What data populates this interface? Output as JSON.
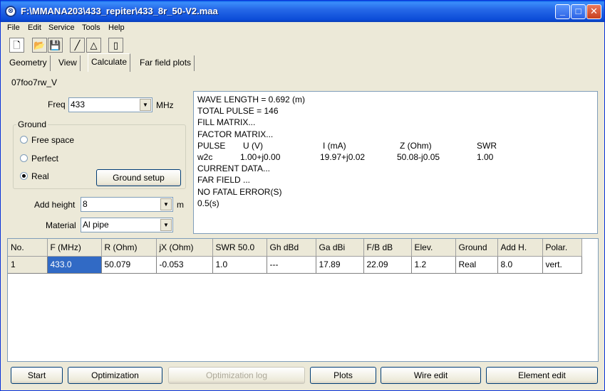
{
  "window": {
    "title": "F:\\MMANA203\\433_repiter\\433_8r_50-V2.maa"
  },
  "menu": [
    "File",
    "Edit",
    "Service",
    "Tools",
    "Help"
  ],
  "toolbar": {
    "icons": [
      "new-file-icon",
      "open-folder-icon",
      "save-disk-icon",
      "line-draw-icon",
      "triangle-icon",
      "document-icon"
    ],
    "glyphs": [
      "🗋",
      "📂",
      "💾",
      "╱",
      "△",
      "▯"
    ]
  },
  "tabs": [
    "Geometry",
    "View",
    "Calculate",
    "Far field plots"
  ],
  "antenna_name": "07foo7rw_V",
  "freq": {
    "label": "Freq",
    "value": "433",
    "unit": "MHz"
  },
  "ground": {
    "title": "Ground",
    "options": [
      "Free space",
      "Perfect",
      "Real"
    ],
    "selected": "Real",
    "setup_button": "Ground setup"
  },
  "add_height": {
    "label": "Add height",
    "value": "8",
    "unit": "m"
  },
  "material": {
    "label": "Material",
    "value": "Al pipe"
  },
  "output": {
    "lines": [
      "WAVE LENGTH = 0.692 (m)",
      "TOTAL PULSE = 146",
      "FILL MATRIX...",
      "FACTOR MATRIX..."
    ],
    "pulse_header": [
      "PULSE",
      "U (V)",
      "I (mA)",
      "Z (Ohm)",
      "SWR"
    ],
    "pulse_row": [
      "w2c",
      "1.00+j0.00",
      "19.97+j0.02",
      "50.08-j0.05",
      "1.00"
    ],
    "tail": [
      "CURRENT DATA...",
      "FAR FIELD ...",
      "NO FATAL ERROR(S)",
      "0.5(s)"
    ]
  },
  "table": {
    "headers": [
      "No.",
      "F (MHz)",
      "R (Ohm)",
      "jX (Ohm)",
      "SWR 50.0",
      "Gh dBd",
      "Ga dBi",
      "F/B dB",
      "Elev.",
      "Ground",
      "Add H.",
      "Polar."
    ],
    "rows": [
      [
        "1",
        "433.0",
        "50.079",
        "-0.053",
        "1.0",
        "---",
        "17.89",
        "22.09",
        "1.2",
        "Real",
        "8.0",
        "vert."
      ]
    ]
  },
  "buttons": {
    "start": "Start",
    "optimization": "Optimization",
    "optimization_log": "Optimization log",
    "plots": "Plots",
    "wire_edit": "Wire edit",
    "element_edit": "Element edit"
  },
  "colors": {
    "titlebar": "#0a5fe6",
    "selection": "#316ac5",
    "face": "#ece9d8"
  }
}
